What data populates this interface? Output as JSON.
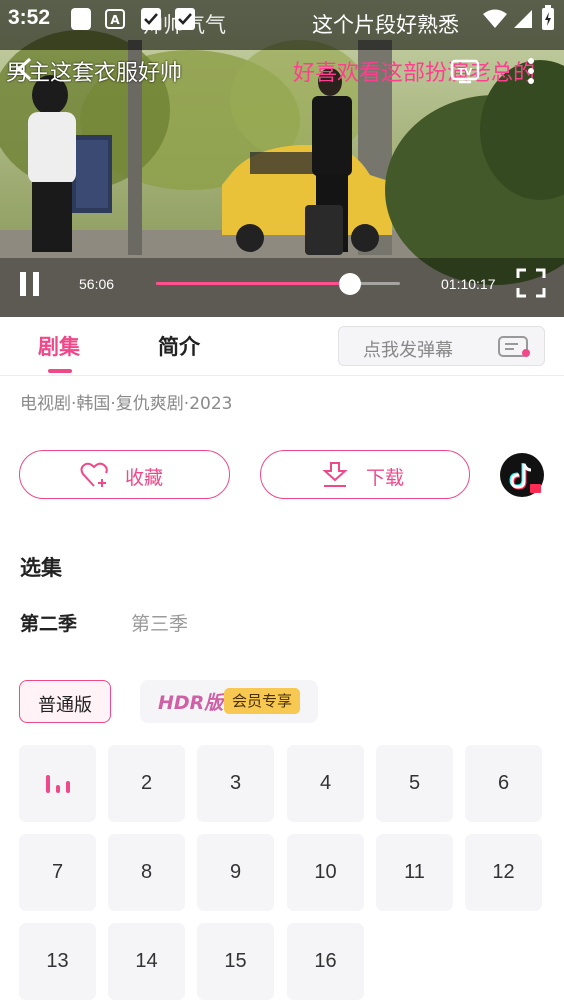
{
  "status_bar": {
    "time": "3:52",
    "notification_text": "这个片段好熟悉",
    "behind_text": "帅帅气气"
  },
  "video": {
    "danmaku": [
      {
        "text": "男主这套衣服好帅",
        "color": "#ffffff"
      },
      {
        "text": "好喜欢看这部扮演老总的",
        "color": "#ff3e8f"
      }
    ],
    "current_time": "56:06",
    "total_time": "01:10:17",
    "progress_percent": 79.5
  },
  "tabs": {
    "episodes": "剧集",
    "intro": "简介",
    "danmu_placeholder": "点我发弹幕"
  },
  "meta": {
    "tags": "电视剧·韩国·复仇爽剧·2023"
  },
  "actions": {
    "collect": "收藏",
    "download": "下载"
  },
  "episodes_section": {
    "title": "选集",
    "seasons": [
      "第二季",
      "第三季"
    ],
    "version_normal": "普通版",
    "version_hdr": "HDR版",
    "vip_badge": "会员专享",
    "episodes": [
      "2",
      "3",
      "4",
      "5",
      "6",
      "7",
      "8",
      "9",
      "10",
      "11",
      "12",
      "13",
      "14",
      "15",
      "16"
    ]
  },
  "colors": {
    "accent": "#f0498a",
    "vip_gold": "#f7c852"
  }
}
